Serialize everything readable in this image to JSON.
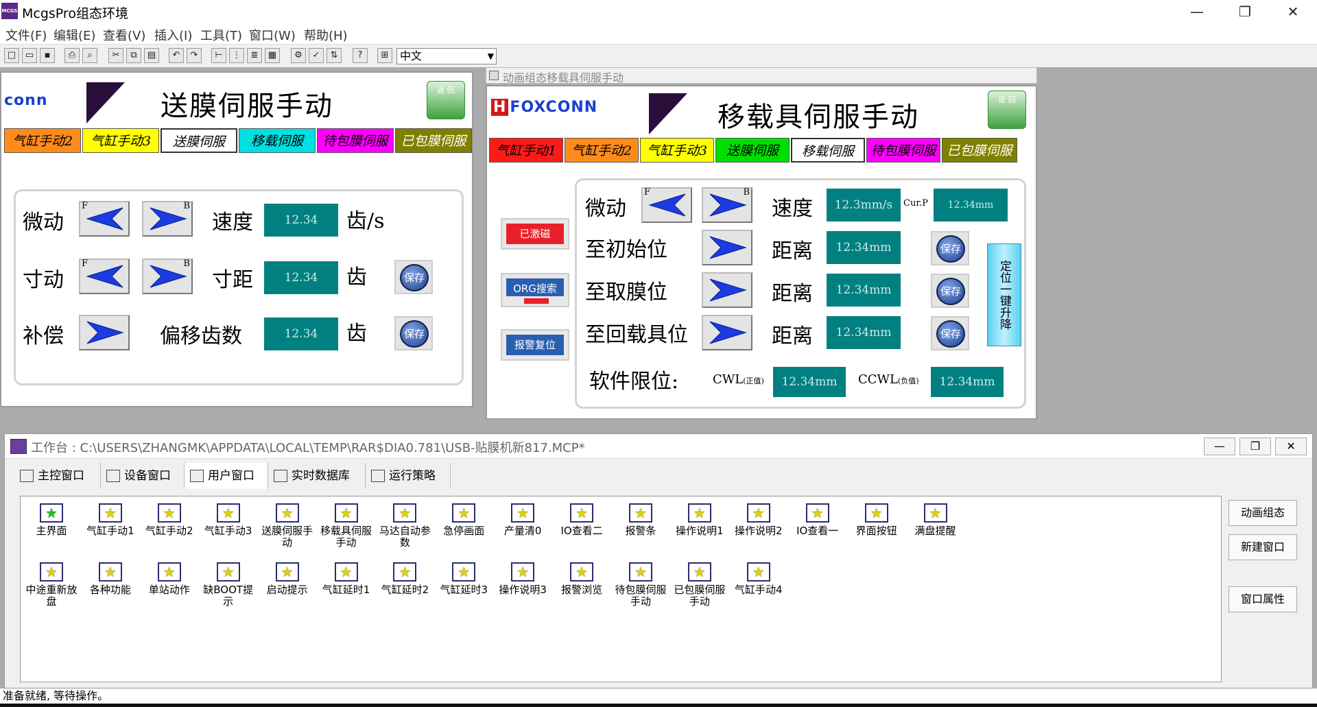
{
  "app": {
    "title": "McgsPro组态环境",
    "icon_text": "MCGS"
  },
  "window_controls": {
    "minimize": "—",
    "restore": "❐",
    "close": "✕"
  },
  "menu": [
    "文件(F)",
    "编辑(E)",
    "查看(V)",
    "插入(I)",
    "工具(T)",
    "窗口(W)",
    "帮助(H)"
  ],
  "toolbar": {
    "language": "中文"
  },
  "window1": {
    "logo": "conn",
    "title": "送膜伺服手动",
    "back_label": "返 回",
    "tabs": [
      {
        "label": "气缸手动2",
        "color": "#ff8c1a"
      },
      {
        "label": "气缸手动3",
        "color": "#ffff00"
      },
      {
        "label": "送膜伺服",
        "color": "#ffffff"
      },
      {
        "label": "移载伺服",
        "color": "#00e0e0"
      },
      {
        "label": "待包膜伺服",
        "color": "#ff00ff"
      },
      {
        "label": "已包膜伺服",
        "color": "#808000"
      }
    ],
    "rows": [
      {
        "label": "微动",
        "f": "F",
        "b": "B",
        "field": "速度",
        "value": "12.34",
        "unit": "齿/s"
      },
      {
        "label": "寸动",
        "f": "F",
        "b": "B",
        "field": "寸距",
        "value": "12.34",
        "unit": "齿",
        "save": "保存"
      },
      {
        "label": "补偿",
        "field": "偏移齿数",
        "value": "12.34",
        "unit": "齿",
        "save": "保存"
      }
    ]
  },
  "window2": {
    "caption": "动画组态移载具伺服手动",
    "logo": "FOXCONN",
    "title": "移载具伺服手动",
    "back_label": "返 回",
    "tabs": [
      {
        "label": "气缸手动1",
        "color": "#ff1a1a"
      },
      {
        "label": "气缸手动2",
        "color": "#ff8c1a"
      },
      {
        "label": "气缸手动3",
        "color": "#ffff00"
      },
      {
        "label": "送膜伺服",
        "color": "#00e000"
      },
      {
        "label": "移载伺服",
        "color": "#ffffff"
      },
      {
        "label": "待包膜伺服",
        "color": "#ff00ff"
      },
      {
        "label": "已包膜伺服",
        "color": "#808000"
      }
    ],
    "side_buttons": [
      {
        "label": "已激磁",
        "color": "#e8202a"
      },
      {
        "label": "ORG搜索",
        "color": "#2a5fb0"
      },
      {
        "label": "报警复位",
        "color": "#2a5fb0"
      }
    ],
    "rows": [
      {
        "label": "微动",
        "f": "F",
        "b": "B",
        "field": "速度",
        "value": "12.3mm/s",
        "extra_label": "Cur.P",
        "extra_value": "12.34mm"
      },
      {
        "label": "至初始位",
        "field": "距离",
        "value": "12.34mm",
        "save": "保存"
      },
      {
        "label": "至取膜位",
        "field": "距离",
        "value": "12.34mm",
        "save": "保存"
      },
      {
        "label": "至回载具位",
        "field": "距离",
        "value": "12.34mm",
        "save": "保存"
      }
    ],
    "soft_limit": {
      "label": "软件限位:",
      "cwl": "CWL",
      "cwl_sub": "(正值)",
      "cwl_value": "12.34mm",
      "ccwl": "CCWL",
      "ccwl_sub": "(负值)",
      "ccwl_value": "12.34mm"
    },
    "lift_button": "定位一键升降"
  },
  "workbench": {
    "title": "工作台 : C:\\USERS\\ZHANGMK\\APPDATA\\LOCAL\\TEMP\\RAR$DIA0.781\\USB-贴膜机新817.MCP*",
    "tabs": [
      "主控窗口",
      "设备窗口",
      "用户窗口",
      "实时数据库",
      "运行策略"
    ],
    "items_row1": [
      "主界面",
      "气缸手动1",
      "气缸手动2",
      "气缸手动3",
      "送膜伺服手动",
      "移载具伺服手动",
      "马达自动参数",
      "急停画面",
      "产量清0",
      "IO查看二",
      "报警条",
      "操作说明1",
      "操作说明2",
      "IO查看一",
      "界面按钮",
      "满盘提醒"
    ],
    "items_row2": [
      "中途重新放盘",
      "各种功能",
      "单站动作",
      "缺BOOT提示",
      "启动提示",
      "气缸延时1",
      "气缸延时2",
      "气缸延时3",
      "操作说明3",
      "报警浏览",
      "待包膜伺服手动",
      "已包膜伺服手动",
      "气缸手动4"
    ],
    "right_buttons": [
      "动画组态",
      "新建窗口",
      "窗口属性"
    ]
  },
  "status": "准备就绪, 等待操作。"
}
